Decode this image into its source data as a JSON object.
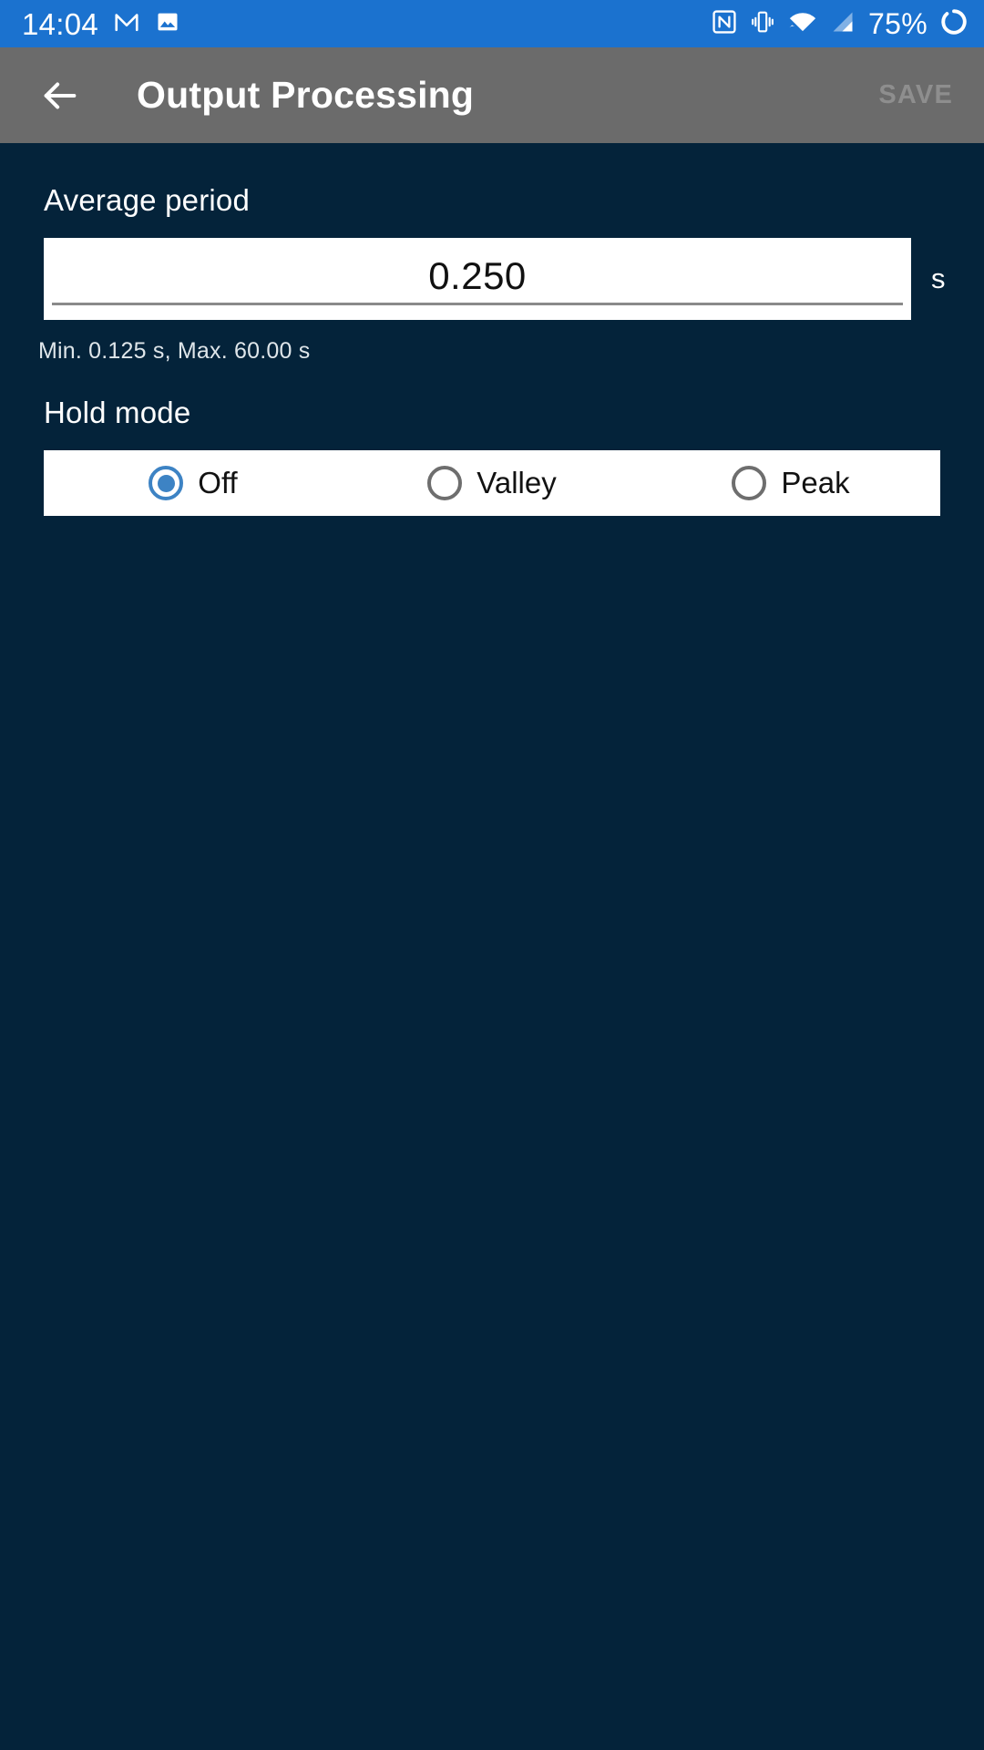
{
  "status_bar": {
    "clock": "14:04",
    "battery_percent": "75%",
    "icons": [
      "gmail-icon",
      "image-icon",
      "nfc-icon",
      "vibrate-icon",
      "wifi-icon",
      "cellular-signal-icon",
      "battery-charging-icon"
    ],
    "background_color": "#1b72cf",
    "foreground_color": "#ffffff"
  },
  "app_bar": {
    "back_label": "back-arrow",
    "title": "Output Processing",
    "save_label": "SAVE",
    "save_enabled": false,
    "background_color": "#6b6b6b",
    "title_color": "#ffffff",
    "save_color": "#8e8e8e"
  },
  "content": {
    "background_color": "#04233a",
    "average_period": {
      "label": "Average period",
      "value": "0.250",
      "placeholder": "0.250",
      "unit": "s",
      "hint": "Min. 0.125 s, Max. 60.00 s",
      "min": "0.125",
      "max": "60.00"
    },
    "hold_mode": {
      "label": "Hold mode",
      "selected": "Off",
      "accent_color": "#3d83c4",
      "options": [
        {
          "label": "Off",
          "checked": true
        },
        {
          "label": "Valley",
          "checked": false
        },
        {
          "label": "Peak",
          "checked": false
        }
      ]
    }
  }
}
